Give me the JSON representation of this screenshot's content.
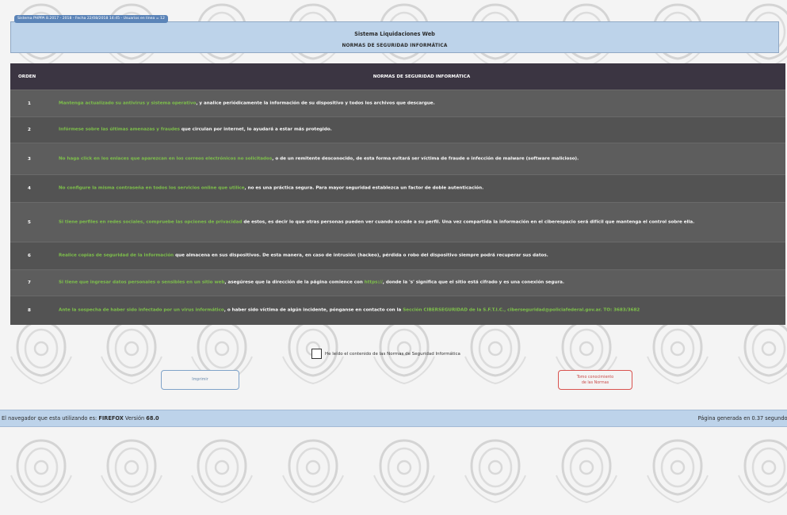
{
  "header": {
    "badge": "Sistema PHPPA 8.2017 - 2018 - Fecha 22/08/2018 14:45 - Usuarios en línea = 12",
    "title": "Sistema Liquidaciones Web",
    "subtitle": "NORMAS DE SEGURIDAD INFORMÁTICA"
  },
  "table": {
    "col_order": "ORDEN",
    "col_title": "NORMAS DE SEGURIDAD INFORMÁTICA",
    "rows": [
      {
        "n": "1",
        "hl": "Mantenga actualizado su antivirus y sistema operativo",
        "rest": ", y analice periódicamente la información de su dispositivo y todos los archivos que descargue."
      },
      {
        "n": "2",
        "hl": "Infórmese sobre las últimas amenazas y fraudes",
        "rest": " que circulan por internet, lo ayudará a estar más protegido."
      },
      {
        "n": "3",
        "hl": "No haga click en los enlaces que aparezcan en los correos electrónicos no solicitados",
        "rest": ", o de un remitente desconocido, de esta forma evitará ser víctima de fraude o infección de malware (software malicioso)."
      },
      {
        "n": "4",
        "hl": "No configure la misma contraseña en todos los servicios online que utilice",
        "rest": ", no es una práctica segura. Para mayor seguridad establezca un factor de doble autenticación."
      },
      {
        "n": "5",
        "hl": "Si tiene perfiles en redes sociales, compruebe las opciones de privacidad",
        "rest": " de estos, es decir lo que otras personas pueden ver cuando accede a su perfil. Una vez compartida la información en el ciberespacio será difícil que mantenga el control sobre ella."
      },
      {
        "n": "6",
        "hl": "Realice copias de seguridad de la información",
        "rest": " que almacena en sus dispositivos. De esta manera, en caso de intrusión (hackeo), pérdida o robo del dispositivo siempre podrá recuperar sus datos."
      },
      {
        "n": "7",
        "hl": "Si tiene que ingresar datos personales o sensibles en un sitio web",
        "rest": ", asegúrese que la dirección de la página comience con ",
        "hl2": "https://",
        "rest2": ", donde la 's' significa que el sitio está cifrado y es una conexión segura."
      },
      {
        "n": "8",
        "hl": "Ante la sospecha de haber sido infectado por un virus informático",
        "rest": ", o haber sido víctima de algún incidente, pónganse en contacto con la ",
        "hl2": "Sección CIBERSEGURIDAD de la S.F.T.I.C., ciberseguridad@policiafederal.gov.ar. TO: 3683/3682",
        "rest2": ""
      }
    ]
  },
  "accept": {
    "label": "He leído el contenido de las Normas de Seguridad Informática"
  },
  "buttons": {
    "print": "Imprimir",
    "accept_line1": "Tomo conocimiento",
    "accept_line2": "de las Normas"
  },
  "footer": {
    "browser_prefix": "El navegador que esta utilizando es: ",
    "browser_name": "FIREFOX",
    "version_prefix": " Versión ",
    "version": "68.0",
    "generated": "Página generada en 0.37 segundos"
  },
  "colors": {
    "header_bg": "#bdd3ea",
    "table_head_bg": "#3b3542",
    "row_bg": "#5a5a5a",
    "highlight_green": "#7ec24a",
    "accept_button": "#d9534f"
  }
}
